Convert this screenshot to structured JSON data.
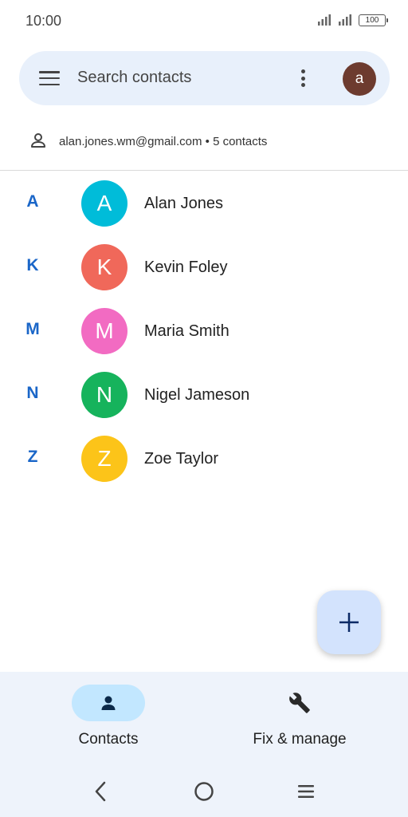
{
  "status": {
    "time": "10:00",
    "battery": "100"
  },
  "search": {
    "placeholder": "Search contacts",
    "avatar_letter": "a",
    "avatar_color": "#6d3b2f"
  },
  "account": {
    "email": "alan.jones.wm@gmail.com",
    "separator": " • ",
    "count": "5 contacts"
  },
  "contacts": [
    {
      "letter": "A",
      "initial": "A",
      "name": "Alan Jones",
      "color": "#00bcd9"
    },
    {
      "letter": "K",
      "initial": "K",
      "name": "Kevin Foley",
      "color": "#f0685a"
    },
    {
      "letter": "M",
      "initial": "M",
      "name": "Maria Smith",
      "color": "#f26bc2"
    },
    {
      "letter": "N",
      "initial": "N",
      "name": "Nigel Jameson",
      "color": "#16b35c"
    },
    {
      "letter": "Z",
      "initial": "Z",
      "name": "Zoe Taylor",
      "color": "#fcc419"
    }
  ],
  "fab": {
    "icon": "plus-icon"
  },
  "bottom_nav": {
    "contacts_label": "Contacts",
    "fix_label": "Fix & manage",
    "active": "Contacts"
  },
  "colors": {
    "accent": "#1a66c8",
    "active_pill": "#c2e7ff",
    "fab": "#d3e3fd"
  }
}
